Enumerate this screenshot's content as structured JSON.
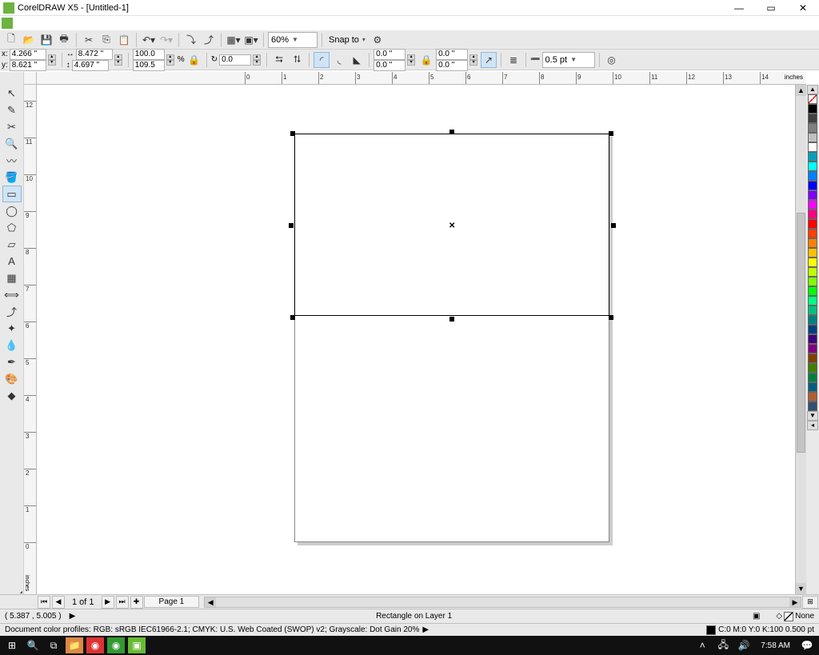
{
  "title": "CorelDRAW X5 - [Untitled-1]",
  "toolbar1": {
    "zoom": "60%",
    "snap_label": "Snap to"
  },
  "propbar": {
    "x_label": "x:",
    "x": "4.266 \"",
    "y_label": "y:",
    "y": "8.621 \"",
    "w": "8.472 \"",
    "h": "4.697 \"",
    "scale_x": "100.0",
    "scale_y": "109.5",
    "scale_unit": "%",
    "angle": "0.0",
    "corner1": "0.0 \"",
    "corner2": "0.0 \"",
    "corner3": "0.0 \"",
    "corner4": "0.0 \"",
    "outline": "0.5 pt"
  },
  "hruler": {
    "unit": "inches",
    "ticks": [
      "0",
      "1",
      "2",
      "3",
      "4",
      "5",
      "6",
      "7",
      "8",
      "9",
      "10",
      "11",
      "12",
      "13",
      "14"
    ]
  },
  "vruler": {
    "unit": "inches",
    "ticks": [
      "12",
      "11",
      "10",
      "9",
      "8",
      "7",
      "6",
      "5",
      "4",
      "3",
      "2",
      "1",
      "0"
    ]
  },
  "palette_colors": [
    "#000000",
    "#404040",
    "#808080",
    "#c0c0c0",
    "#ffffff",
    "#00a0c0",
    "#00ffff",
    "#0080ff",
    "#0000ff",
    "#8000ff",
    "#ff00ff",
    "#ff0080",
    "#ff0000",
    "#ff4000",
    "#ff8000",
    "#ffc000",
    "#ffff00",
    "#c0ff00",
    "#80ff00",
    "#00ff00",
    "#00ff80",
    "#00c080",
    "#008080",
    "#004080",
    "#400080",
    "#800080",
    "#804000",
    "#408000",
    "#008040",
    "#006080",
    "#b06030",
    "#305070"
  ],
  "pagenav": {
    "counter": "1 of 1",
    "tab": "Page 1"
  },
  "status1": {
    "cursor": "( 5.387 , 5.005 )",
    "object": "Rectangle on Layer 1",
    "fill_label": "None",
    "outline_label": "C:0 M:0 Y:0 K:100  0.500 pt"
  },
  "status2": {
    "profiles": "Document color profiles: RGB: sRGB IEC61966-2.1; CMYK: U.S. Web Coated (SWOP) v2; Grayscale: Dot Gain 20%"
  },
  "taskbar": {
    "time": "7:58 AM"
  }
}
